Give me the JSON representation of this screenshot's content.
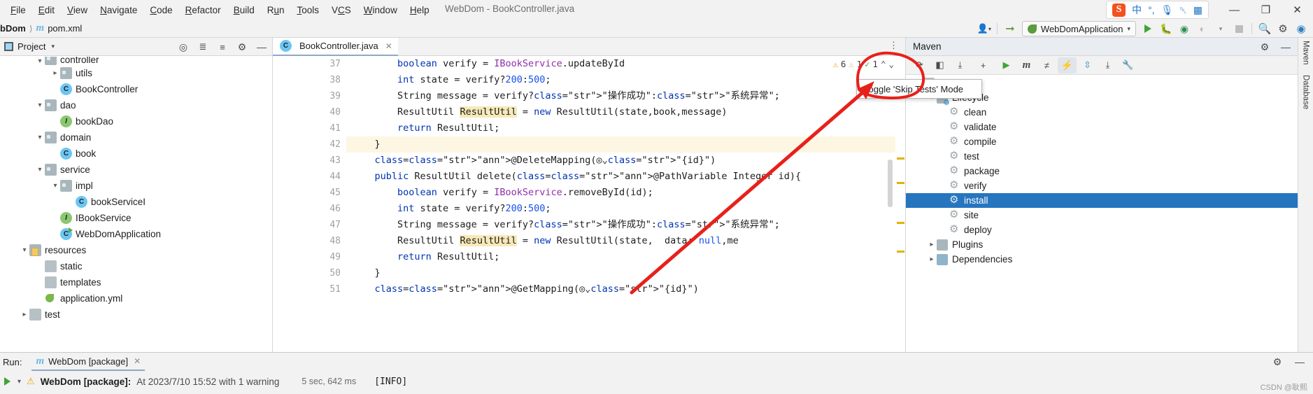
{
  "window": {
    "title": "WebDom - BookController.java",
    "menu": [
      "File",
      "Edit",
      "View",
      "Navigate",
      "Code",
      "Refactor",
      "Build",
      "Run",
      "Tools",
      "VCS",
      "Window",
      "Help"
    ],
    "controls": {
      "minimize": "—",
      "restore": "❐",
      "close": "✕"
    },
    "ime": {
      "logo": "S",
      "lang": "中",
      "punct": "°,",
      "mic": "🎙",
      "keyboard": "⌸",
      "apps": "▦"
    }
  },
  "navbar": {
    "crumb_project": "bDom",
    "crumb_sep": "⟩",
    "crumb_file": "pom.xml",
    "run_config": "WebDomApplication",
    "icons": {
      "user": "user-icon",
      "hammer": "build-icon",
      "run": "run-icon",
      "debug": "debug-icon",
      "coverage": "run-with-coverage-icon",
      "profile": "profiler-icon",
      "stop": "stop-icon",
      "search": "search-everywhere-icon",
      "settings": "settings-icon",
      "ide": "ide-icon"
    }
  },
  "project_panel": {
    "title": "Project",
    "actions": [
      "locate-icon",
      "expand-all-icon",
      "collapse-all-icon",
      "settings-icon",
      "hide-icon"
    ],
    "tree": [
      {
        "label": "controller",
        "kind": "folder",
        "indent": 3,
        "arrow": "down",
        "clipped": true
      },
      {
        "label": "utils",
        "kind": "folder",
        "indent": 4,
        "arrow": "right"
      },
      {
        "label": "BookController",
        "kind": "class",
        "indent": 4,
        "arrow": "none"
      },
      {
        "label": "dao",
        "kind": "folder",
        "indent": 3,
        "arrow": "down"
      },
      {
        "label": "bookDao",
        "kind": "interface",
        "indent": 4,
        "arrow": "none"
      },
      {
        "label": "domain",
        "kind": "folder",
        "indent": 3,
        "arrow": "down"
      },
      {
        "label": "book",
        "kind": "class",
        "indent": 4,
        "arrow": "none"
      },
      {
        "label": "service",
        "kind": "folder",
        "indent": 3,
        "arrow": "down"
      },
      {
        "label": "impl",
        "kind": "folder",
        "indent": 4,
        "arrow": "down"
      },
      {
        "label": "bookServiceI",
        "kind": "class",
        "indent": 5,
        "arrow": "none"
      },
      {
        "label": "IBookService",
        "kind": "interface",
        "indent": 4,
        "arrow": "none"
      },
      {
        "label": "WebDomApplication",
        "kind": "spring-class",
        "indent": 4,
        "arrow": "none"
      },
      {
        "label": "resources",
        "kind": "resource-folder",
        "indent": 2,
        "arrow": "down"
      },
      {
        "label": "static",
        "kind": "folder-plain",
        "indent": 3,
        "arrow": "none"
      },
      {
        "label": "templates",
        "kind": "folder-plain",
        "indent": 3,
        "arrow": "none"
      },
      {
        "label": "application.yml",
        "kind": "yaml",
        "indent": 3,
        "arrow": "none"
      },
      {
        "label": "test",
        "kind": "folder-plain",
        "indent": 2,
        "arrow": "right"
      }
    ]
  },
  "editor": {
    "tab": {
      "label": "BookController.java",
      "close": "✕",
      "icon": "java-class-icon"
    },
    "more_icon": "⋮",
    "inspection": {
      "warnings": "6",
      "weak_warnings": "1",
      "typos": "1",
      "up": "⌃",
      "down": "⌄"
    },
    "first_line": 37,
    "lines": [
      {
        "n": 37,
        "code": "        boolean verify = IBookService.updateById"
      },
      {
        "n": 38,
        "code": "        int state = verify?200:500;"
      },
      {
        "n": 39,
        "code": "        String message = verify?\"操作成功\":\"系统异常\";"
      },
      {
        "n": 40,
        "code": "        ResultUtil ResultUtil = new ResultUtil(state,book,message)"
      },
      {
        "n": 41,
        "code": "        return ResultUtil;"
      },
      {
        "n": 42,
        "code": "    }"
      },
      {
        "n": 43,
        "code": "    @DeleteMapping(◎⌄\"{id}\")"
      },
      {
        "n": 44,
        "code": "    public ResultUtil delete(@PathVariable Integer id){"
      },
      {
        "n": 45,
        "code": "        boolean verify = IBookService.removeById(id);"
      },
      {
        "n": 46,
        "code": "        int state = verify?200:500;"
      },
      {
        "n": 47,
        "code": "        String message = verify?\"操作成功\":\"系统异常\";"
      },
      {
        "n": 48,
        "code": "        ResultUtil ResultUtil = new ResultUtil(state,  data: null,me"
      },
      {
        "n": 49,
        "code": "        return ResultUtil;"
      },
      {
        "n": 50,
        "code": "    }"
      },
      {
        "n": 51,
        "code": "    @GetMapping(◎⌄\"{id}\")"
      }
    ],
    "highlighted_line": 42
  },
  "maven": {
    "title": "Maven",
    "head_actions": [
      "settings-icon",
      "hide-icon"
    ],
    "toolbar": [
      {
        "name": "reload-all-maven-projects",
        "glyph": "⟳"
      },
      {
        "name": "generate-sources-icon",
        "glyph": "◧"
      },
      {
        "name": "download-sources-icon",
        "glyph": "⤓"
      },
      {
        "name": "add-maven-project-icon",
        "glyph": "+"
      },
      {
        "name": "run-maven-build-icon",
        "glyph": "▶"
      },
      {
        "name": "execute-maven-goal-icon",
        "glyph": "m"
      },
      {
        "name": "toggle-offline-mode-icon",
        "glyph": "≠"
      },
      {
        "name": "toggle-skip-tests-mode-icon",
        "glyph": "⚡"
      },
      {
        "name": "show-dependencies-icon",
        "glyph": "⇳"
      },
      {
        "name": "collapse-all-icon",
        "glyph": "⤓"
      },
      {
        "name": "maven-settings-icon",
        "glyph": "🔧"
      }
    ],
    "tooltip": "Toggle 'Skip Tests' Mode",
    "tree": [
      {
        "label": "WebDom",
        "indent": 1,
        "arrow": "down",
        "icon": "maven-project"
      },
      {
        "label": "Lifecycle",
        "indent": 2,
        "arrow": "down",
        "icon": "lifecycle"
      },
      {
        "label": "clean",
        "indent": 3,
        "arrow": "none",
        "icon": "goal"
      },
      {
        "label": "validate",
        "indent": 3,
        "arrow": "none",
        "icon": "goal"
      },
      {
        "label": "compile",
        "indent": 3,
        "arrow": "none",
        "icon": "goal"
      },
      {
        "label": "test",
        "indent": 3,
        "arrow": "none",
        "icon": "goal"
      },
      {
        "label": "package",
        "indent": 3,
        "arrow": "none",
        "icon": "goal"
      },
      {
        "label": "verify",
        "indent": 3,
        "arrow": "none",
        "icon": "goal"
      },
      {
        "label": "install",
        "indent": 3,
        "arrow": "none",
        "icon": "goal",
        "selected": true
      },
      {
        "label": "site",
        "indent": 3,
        "arrow": "none",
        "icon": "goal"
      },
      {
        "label": "deploy",
        "indent": 3,
        "arrow": "none",
        "icon": "goal"
      },
      {
        "label": "Plugins",
        "indent": 2,
        "arrow": "right",
        "icon": "plugins"
      },
      {
        "label": "Dependencies",
        "indent": 2,
        "arrow": "right",
        "icon": "dependencies"
      }
    ]
  },
  "right_bar": {
    "items": [
      "Maven",
      "Database"
    ]
  },
  "run_panel": {
    "label": "Run:",
    "tab": "WebDom [package]",
    "tab_close": "✕",
    "result_title": "WebDom [package]:",
    "result_detail": "At 2023/7/10 15:52 with 1 warning",
    "timing": "5 sec, 642 ms",
    "console_first": "[INFO]",
    "actions": [
      "settings-icon",
      "hide-icon"
    ]
  },
  "watermark": "CSDN @耿熙",
  "colors": {
    "selection_blue": "#2675bf",
    "annotation_red": "#e8201b",
    "keyword_blue": "#0033b3",
    "string_green": "#067d17",
    "number_blue": "#1750eb",
    "annotation_yellow": "#9e880d",
    "class_purple": "#8f2ea8"
  }
}
